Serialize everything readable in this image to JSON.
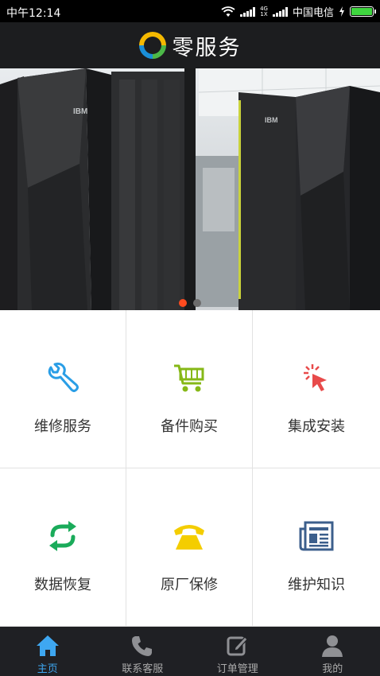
{
  "status_bar": {
    "time": "中午12:14",
    "network_top": "4G",
    "network_bottom": "1X",
    "carrier": "中国电信",
    "battery_level": 1.0
  },
  "header": {
    "title": "零服务",
    "logo_icon": "ring-logo"
  },
  "banner": {
    "slide_count": 2,
    "active_slide": 0,
    "left_brand": "IBM",
    "right_brand": "IBM",
    "dot_colors": {
      "active": "#ff4b1f",
      "inactive": "#6c6c6c"
    }
  },
  "services": [
    {
      "label": "维修服务",
      "icon": "wrench-icon",
      "color": "#2a9ee6"
    },
    {
      "label": "备件购买",
      "icon": "cart-icon",
      "color": "#86b817"
    },
    {
      "label": "集成安装",
      "icon": "cursor-click-icon",
      "color": "#e84a4a"
    },
    {
      "label": "数据恢复",
      "icon": "sync-icon",
      "color": "#1aab5a"
    },
    {
      "label": "原厂保修",
      "icon": "phone-icon",
      "color": "#f4cd00"
    },
    {
      "label": "维护知识",
      "icon": "newspaper-icon",
      "color": "#3c5f8c"
    }
  ],
  "tabs": [
    {
      "label": "主页",
      "icon": "home-icon",
      "active": true
    },
    {
      "label": "联系客服",
      "icon": "phone-handset-icon",
      "active": false
    },
    {
      "label": "订单管理",
      "icon": "edit-icon",
      "active": false
    },
    {
      "label": "我的",
      "icon": "user-icon",
      "active": false
    }
  ],
  "colors": {
    "header_bg": "#1c1d1f",
    "tabbar_bg": "#1f2024",
    "tab_active": "#3ea7f1",
    "tab_inactive": "#aaaaaa"
  }
}
